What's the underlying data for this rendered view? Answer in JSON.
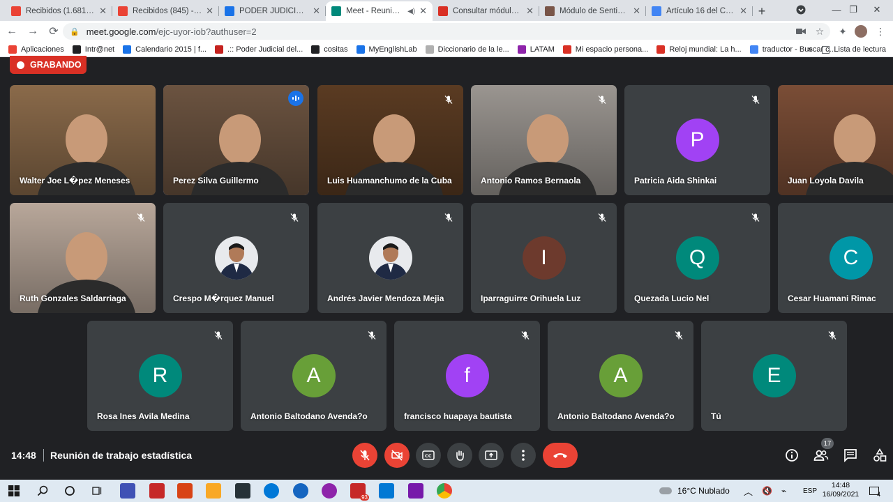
{
  "browser": {
    "tabs": [
      {
        "label": "Recibidos (1.681) - m",
        "color": "#ea4335"
      },
      {
        "label": "Recibidos (845) - elvia",
        "color": "#ea4335"
      },
      {
        "label": "PODER JUDICIAL DEL",
        "color": "#1a73e8"
      },
      {
        "label": "Meet - Reunión d",
        "color": "#00897b",
        "active": true
      },
      {
        "label": "Consultar módulo de",
        "color": "#d93025"
      },
      {
        "label": "Módulo de Sentido de",
        "color": "#795548"
      },
      {
        "label": "Artículo 16 del Códig",
        "color": "#4285f4"
      }
    ],
    "url_host": "meet.google.com",
    "url_path": "/ejc-uyor-iob?authuser=2",
    "bookmarks": [
      {
        "label": "Aplicaciones",
        "color": "#ea4335"
      },
      {
        "label": "Intr@net",
        "color": "#202124"
      },
      {
        "label": "Calendario 2015 | f...",
        "color": "#1a73e8"
      },
      {
        "label": ".:: Poder Judicial del...",
        "color": "#c5221f"
      },
      {
        "label": "cositas",
        "color": "#202124"
      },
      {
        "label": "MyEnglishLab",
        "color": "#1a73e8"
      },
      {
        "label": "Diccionario de la le...",
        "color": "#b0b0b0"
      },
      {
        "label": "LATAM",
        "color": "#8e24aa"
      },
      {
        "label": "Mi espacio persona...",
        "color": "#d93025"
      },
      {
        "label": "Reloj mundial: La h...",
        "color": "#d93025"
      },
      {
        "label": "traductor - Buscar c...",
        "color": "#4285f4"
      }
    ],
    "bookmarks_more": "»",
    "reading_list": "Lista de lectura"
  },
  "meet": {
    "recording_label": "GRABANDO",
    "participants": [
      {
        "name": "Walter Joe L�pez Meneses",
        "kind": "video",
        "bg": "#8a6a4a"
      },
      {
        "name": "Perez Silva Guillermo",
        "kind": "video",
        "bg": "#6b5340",
        "speaking": true
      },
      {
        "name": "Luis Huamanchumo de la Cuba",
        "kind": "video",
        "bg": "#5a3b22",
        "muted": true
      },
      {
        "name": "Antonio Ramos Bernaola",
        "kind": "video",
        "bg": "#9a9590",
        "muted": true
      },
      {
        "name": "Patricia Aida Shinkai",
        "kind": "avatar",
        "letter": "P",
        "color": "#a142f4",
        "muted": true
      },
      {
        "name": "Juan Loyola Davila",
        "kind": "video",
        "bg": "#7a4d36"
      },
      {
        "name": "Ruth Gonzales Saldarriaga",
        "kind": "video",
        "bg": "#b8a79a",
        "muted": true
      },
      {
        "name": "Crespo M�rquez Manuel",
        "kind": "photo",
        "muted": true
      },
      {
        "name": "Andrés Javier Mendoza Mejia",
        "kind": "photo",
        "muted": true
      },
      {
        "name": "Iparraguirre Orihuela Luz",
        "kind": "avatar",
        "letter": "I",
        "color": "#6d3a2d",
        "muted": true
      },
      {
        "name": "Quezada Lucio Nel",
        "kind": "avatar",
        "letter": "Q",
        "color": "#00897b",
        "muted": true
      },
      {
        "name": "Cesar Huamani Rimac",
        "kind": "avatar",
        "letter": "C",
        "color": "#0097a7",
        "muted": true
      },
      {
        "name": "Rosa Ines Avila Medina",
        "kind": "avatar",
        "letter": "R",
        "color": "#00897b",
        "muted": true
      },
      {
        "name": "Antonio Baltodano Avenda?o",
        "kind": "avatar",
        "letter": "A",
        "color": "#689f38",
        "muted": true
      },
      {
        "name": "francisco huapaya bautista",
        "kind": "avatar",
        "letter": "f",
        "color": "#a142f4",
        "muted": true
      },
      {
        "name": "Antonio Baltodano Avenda?o",
        "kind": "avatar",
        "letter": "A",
        "color": "#689f38",
        "muted": true
      },
      {
        "name": "Tú",
        "kind": "avatar",
        "letter": "E",
        "color": "#00897b",
        "muted": true
      }
    ],
    "time": "14:48",
    "meeting_title": "Reunión de trabajo estadística",
    "participant_count": "17"
  },
  "taskbar": {
    "weather": "16°C  Nublado",
    "language": "ESP",
    "clock_time": "14:48",
    "clock_date": "16/09/2021",
    "notif_count": "4",
    "app_badge": "93"
  }
}
